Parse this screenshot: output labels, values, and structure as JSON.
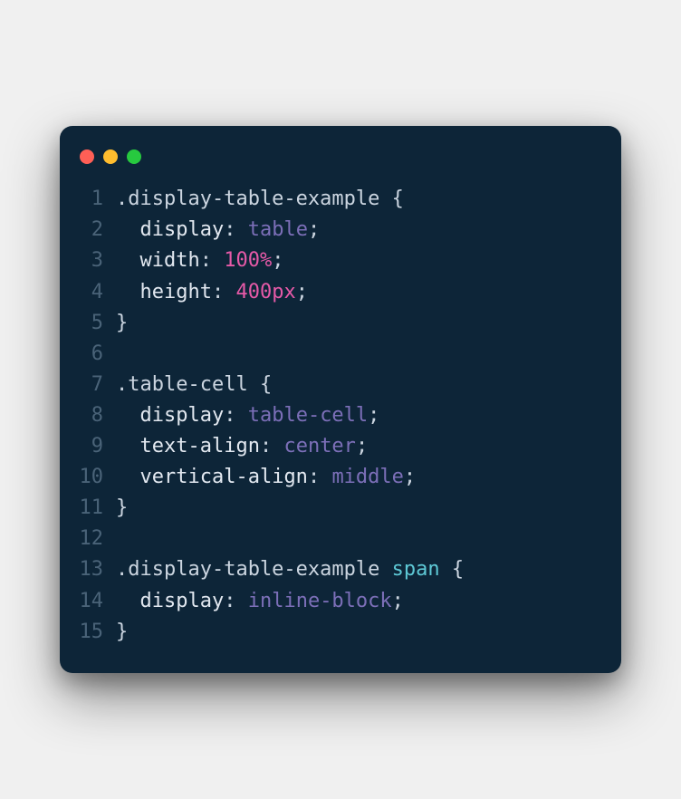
{
  "window": {
    "dots": [
      "red",
      "yellow",
      "green"
    ]
  },
  "code": {
    "lines": [
      {
        "n": "1",
        "tokens": [
          {
            "t": ".display-table-example ",
            "c": "tok-selector"
          },
          {
            "t": "{",
            "c": "tok-punct"
          }
        ]
      },
      {
        "n": "2",
        "tokens": [
          {
            "t": "  ",
            "c": "tok-punct"
          },
          {
            "t": "display",
            "c": "tok-prop"
          },
          {
            "t": ": ",
            "c": "tok-colon"
          },
          {
            "t": "table",
            "c": "tok-kw"
          },
          {
            "t": ";",
            "c": "tok-punct"
          }
        ]
      },
      {
        "n": "3",
        "tokens": [
          {
            "t": "  ",
            "c": "tok-punct"
          },
          {
            "t": "width",
            "c": "tok-prop"
          },
          {
            "t": ": ",
            "c": "tok-colon"
          },
          {
            "t": "100%",
            "c": "tok-num"
          },
          {
            "t": ";",
            "c": "tok-punct"
          }
        ]
      },
      {
        "n": "4",
        "tokens": [
          {
            "t": "  ",
            "c": "tok-punct"
          },
          {
            "t": "height",
            "c": "tok-prop"
          },
          {
            "t": ": ",
            "c": "tok-colon"
          },
          {
            "t": "400px",
            "c": "tok-num"
          },
          {
            "t": ";",
            "c": "tok-punct"
          }
        ]
      },
      {
        "n": "5",
        "tokens": [
          {
            "t": "}",
            "c": "tok-punct"
          }
        ]
      },
      {
        "n": "6",
        "tokens": [
          {
            "t": "",
            "c": "tok-punct"
          }
        ]
      },
      {
        "n": "7",
        "tokens": [
          {
            "t": ".table-cell ",
            "c": "tok-selector"
          },
          {
            "t": "{",
            "c": "tok-punct"
          }
        ]
      },
      {
        "n": "8",
        "tokens": [
          {
            "t": "  ",
            "c": "tok-punct"
          },
          {
            "t": "display",
            "c": "tok-prop"
          },
          {
            "t": ": ",
            "c": "tok-colon"
          },
          {
            "t": "table-cell",
            "c": "tok-kw"
          },
          {
            "t": ";",
            "c": "tok-punct"
          }
        ]
      },
      {
        "n": "9",
        "tokens": [
          {
            "t": "  ",
            "c": "tok-punct"
          },
          {
            "t": "text-align",
            "c": "tok-prop"
          },
          {
            "t": ": ",
            "c": "tok-colon"
          },
          {
            "t": "center",
            "c": "tok-kw"
          },
          {
            "t": ";",
            "c": "tok-punct"
          }
        ]
      },
      {
        "n": "10",
        "tokens": [
          {
            "t": "  ",
            "c": "tok-punct"
          },
          {
            "t": "vertical-align",
            "c": "tok-prop"
          },
          {
            "t": ": ",
            "c": "tok-colon"
          },
          {
            "t": "middle",
            "c": "tok-kw"
          },
          {
            "t": ";",
            "c": "tok-punct"
          }
        ]
      },
      {
        "n": "11",
        "tokens": [
          {
            "t": "}",
            "c": "tok-punct"
          }
        ]
      },
      {
        "n": "12",
        "tokens": [
          {
            "t": "",
            "c": "tok-punct"
          }
        ]
      },
      {
        "n": "13",
        "tokens": [
          {
            "t": ".display-table-example ",
            "c": "tok-selector"
          },
          {
            "t": "span",
            "c": "tok-tag"
          },
          {
            "t": " ",
            "c": "tok-punct"
          },
          {
            "t": "{",
            "c": "tok-punct"
          }
        ]
      },
      {
        "n": "14",
        "tokens": [
          {
            "t": "  ",
            "c": "tok-punct"
          },
          {
            "t": "display",
            "c": "tok-prop"
          },
          {
            "t": ": ",
            "c": "tok-colon"
          },
          {
            "t": "inline-block",
            "c": "tok-kw"
          },
          {
            "t": ";",
            "c": "tok-punct"
          }
        ]
      },
      {
        "n": "15",
        "tokens": [
          {
            "t": "}",
            "c": "tok-punct"
          }
        ]
      }
    ]
  }
}
